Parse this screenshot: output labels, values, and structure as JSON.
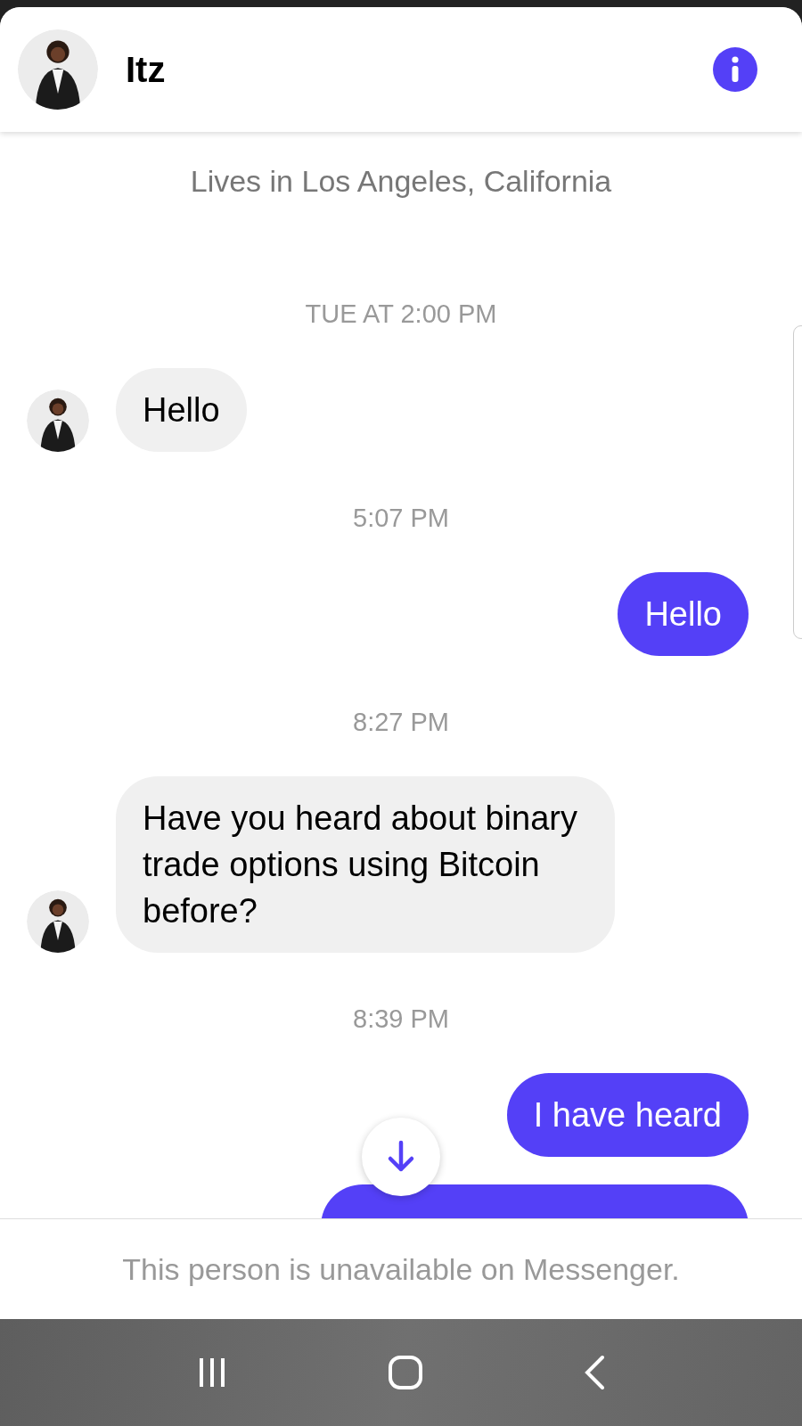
{
  "header": {
    "name": "Itz"
  },
  "profile": [
    "Lives in Los Angeles, California"
  ],
  "messages": [
    {
      "kind": "timestamp",
      "text": "TUE AT 2:00 PM"
    },
    {
      "kind": "incoming",
      "text": "Hello"
    },
    {
      "kind": "timestamp",
      "text": "5:07 PM"
    },
    {
      "kind": "outgoing",
      "text": "Hello"
    },
    {
      "kind": "timestamp",
      "text": "8:27 PM"
    },
    {
      "kind": "incoming",
      "text": "Have you heard about binary trade options using Bitcoin before?"
    },
    {
      "kind": "timestamp",
      "text": "8:39 PM"
    },
    {
      "kind": "outgoing",
      "text": "I have heard"
    },
    {
      "kind": "hidden"
    }
  ],
  "footer": {
    "notice": "This person is unavailable on Messenger."
  }
}
